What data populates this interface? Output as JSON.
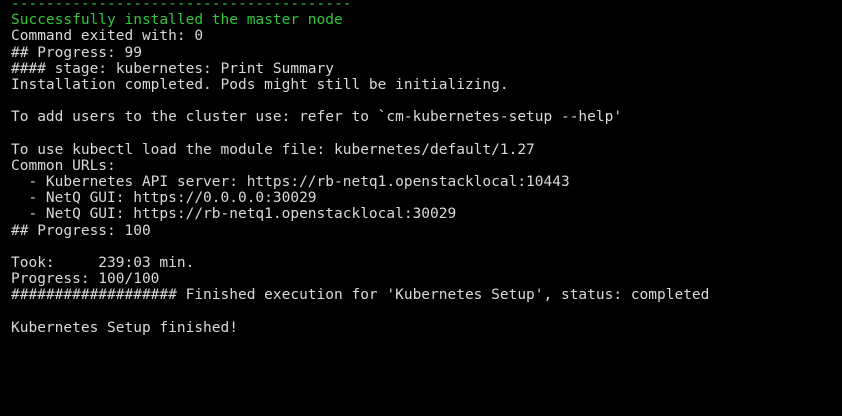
{
  "terminal": {
    "text_color": "#d9d9d9",
    "background_color": "#000000",
    "success_color": "#31c63a",
    "lines": [
      {
        "text": "---------------------------------------",
        "style": "green"
      },
      {
        "text": "Successfully installed the master node",
        "style": "green"
      },
      {
        "text": "Command exited with: 0",
        "style": "normal"
      },
      {
        "text": "## Progress: 99",
        "style": "normal"
      },
      {
        "text": "#### stage: kubernetes: Print Summary",
        "style": "normal"
      },
      {
        "text": "Installation completed. Pods might still be initializing.",
        "style": "normal"
      },
      {
        "text": "",
        "style": "normal"
      },
      {
        "text": "To add users to the cluster use: refer to `cm-kubernetes-setup --help'",
        "style": "normal"
      },
      {
        "text": "",
        "style": "normal"
      },
      {
        "text": "To use kubectl load the module file: kubernetes/default/1.27",
        "style": "normal"
      },
      {
        "text": "Common URLs:",
        "style": "normal"
      },
      {
        "text": "  - Kubernetes API server: https://rb-netq1.openstacklocal:10443",
        "style": "normal"
      },
      {
        "text": "  - NetQ GUI: https://0.0.0.0:30029",
        "style": "normal"
      },
      {
        "text": "  - NetQ GUI: https://rb-netq1.openstacklocal:30029",
        "style": "normal"
      },
      {
        "text": "## Progress: 100",
        "style": "normal"
      },
      {
        "text": "",
        "style": "normal"
      },
      {
        "text": "Took:     239:03 min.",
        "style": "normal"
      },
      {
        "text": "Progress: 100/100",
        "style": "normal"
      },
      {
        "text": "################### Finished execution for 'Kubernetes Setup', status: completed",
        "style": "normal"
      },
      {
        "text": "",
        "style": "normal"
      },
      {
        "text": "Kubernetes Setup finished!",
        "style": "normal"
      }
    ]
  }
}
